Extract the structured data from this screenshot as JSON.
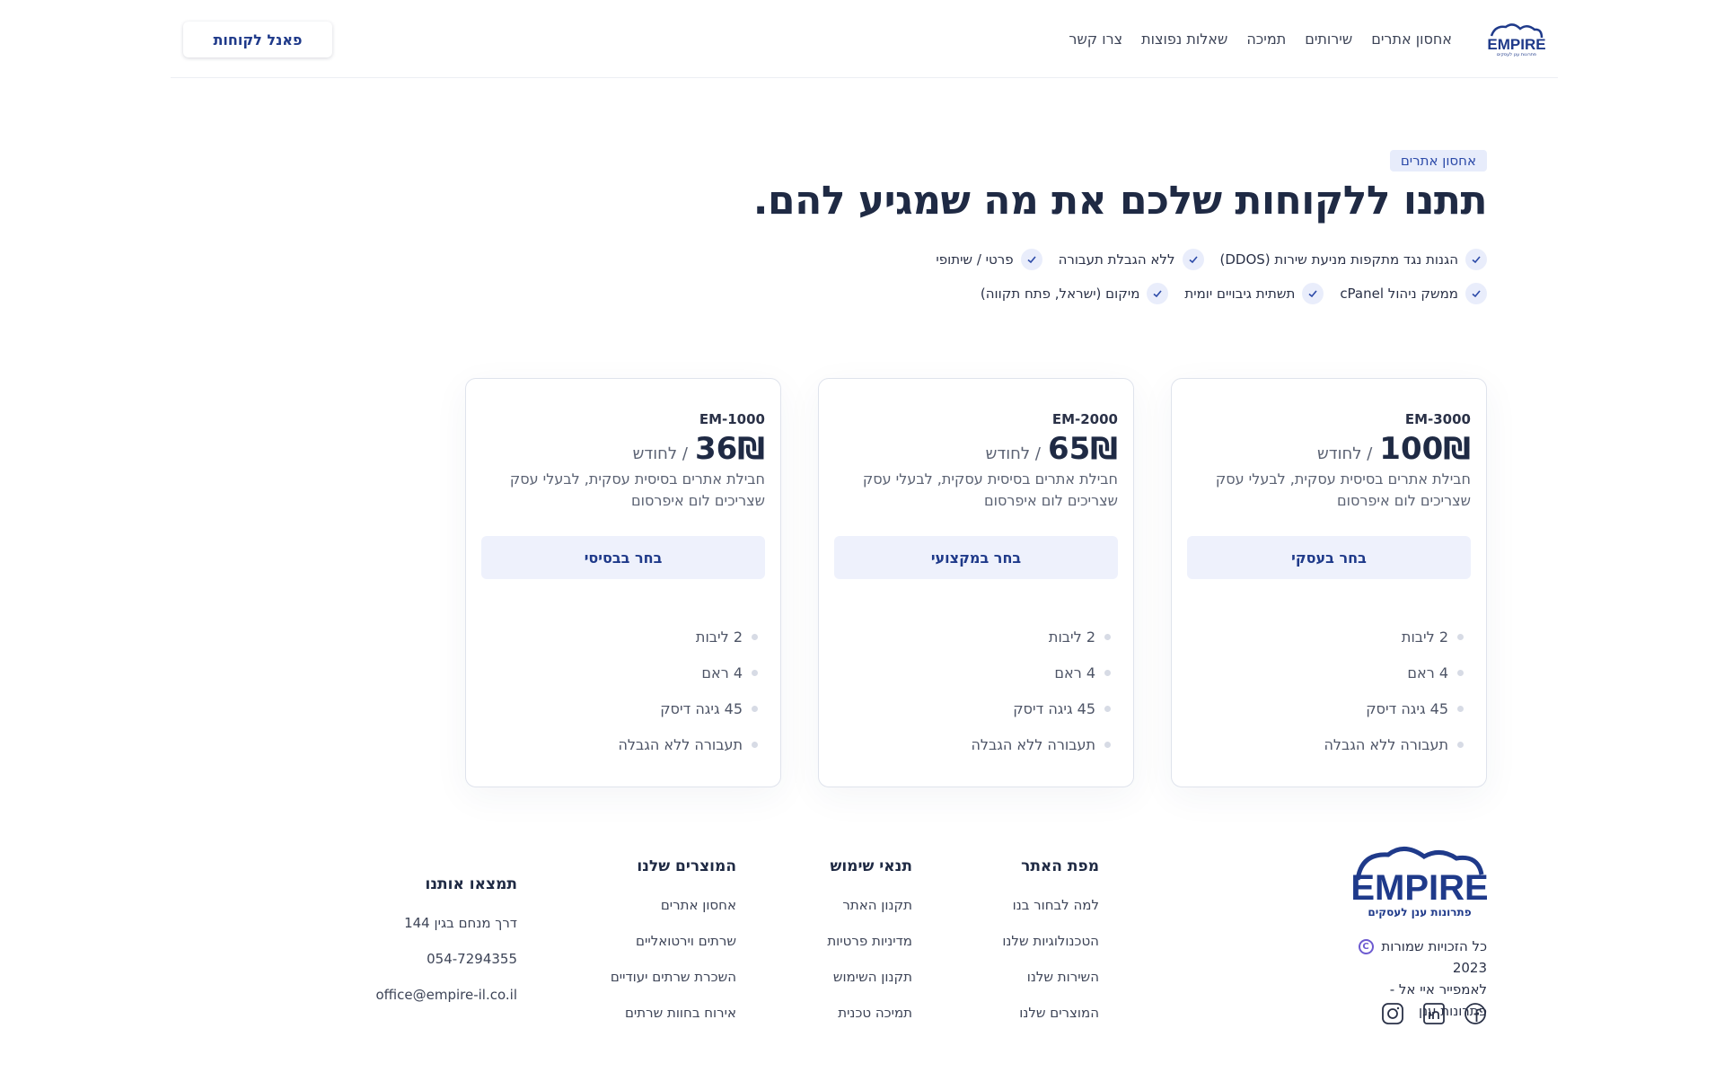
{
  "header": {
    "logo_text": "EMPIRE",
    "logo_tagline": "פתרונות ענן לעסקים",
    "nav": [
      "אחסון אתרים",
      "שירותים",
      "תמיכה",
      "שאלות נפוצות",
      "צרו קשר"
    ],
    "client_panel": "פאנל לקוחות"
  },
  "hero": {
    "badge": "אחסון אתרים",
    "headline": "תתנו ללקוחות שלכם את מה שמגיע להם.",
    "features_row1": [
      "הגנות נגד מתקפות מניעת שירות (DDOS)",
      "ללא הגבלת תעבורה",
      "פרטי / שיתופי"
    ],
    "features_row2": [
      "ממשק ניהול cPanel",
      "תשתית גיבויים יומית",
      "מיקום (ישראל, פתח תקווה)"
    ]
  },
  "plans": [
    {
      "name": "EM-3000",
      "price": "100₪",
      "period": "/ לחודש",
      "description": "חבילת אתרים בסיסית עסקית, לבעלי עסק שצריכים לום איפרסום",
      "button": "בחר בעסקי",
      "specs": [
        "2 ליבות",
        "4 ראם",
        "45 גיגה דיסק",
        "תעבורה ללא הגבלה"
      ]
    },
    {
      "name": "EM-2000",
      "price": "65₪",
      "period": "/ לחודש",
      "description": "חבילת אתרים בסיסית עסקית, לבעלי עסק שצריכים לום איפרסום",
      "button": "בחר במקצועי",
      "specs": [
        "2 ליבות",
        "4 ראם",
        "45 גיגה דיסק",
        "תעבורה ללא הגבלה"
      ]
    },
    {
      "name": "EM-1000",
      "price": "36₪",
      "period": "/ לחודש",
      "description": "חבילת אתרים בסיסית עסקית, לבעלי עסק שצריכים לום איפרסום",
      "button": "בחר בבסיסי",
      "specs": [
        "2 ליבות",
        "4 ראם",
        "45 גיגה דיסק",
        "תעבורה ללא הגבלה"
      ]
    }
  ],
  "footer": {
    "copyright_line1": "כל הזכויות שמורות",
    "copyright_year": "2023",
    "copyright_line2": "לאמפייר איי אל - פתרונות ענן",
    "socials": [
      "facebook-icon",
      "linkedin-icon",
      "instagram-icon"
    ],
    "columns": [
      {
        "title": "מפת האתר",
        "items": [
          "למה לבחור בנו",
          "הטכנולוגיות שלנו",
          "השירות שלנו",
          "המוצרים שלנו"
        ]
      },
      {
        "title": "תנאי שימוש",
        "items": [
          "תקנון האתר",
          "מדיניות פרטיות",
          "תקנון השימוש",
          "תמיכה טכנית"
        ]
      },
      {
        "title": "המוצרים שלנו",
        "items": [
          "אחסון אתרים",
          "שרתים וירטואליים",
          "השכרת שרתים יעודיים",
          "אירוח בחוות שרתים"
        ]
      },
      {
        "title": "תמצאו אותנו",
        "items": [
          "דרך מנחם בגין 144",
          "054-7294355",
          "office@empire-il.co.il"
        ]
      }
    ]
  },
  "colors": {
    "brand": "#1f3a8a",
    "heading": "#1f2a44",
    "accent_bg": "#eef1fc"
  }
}
